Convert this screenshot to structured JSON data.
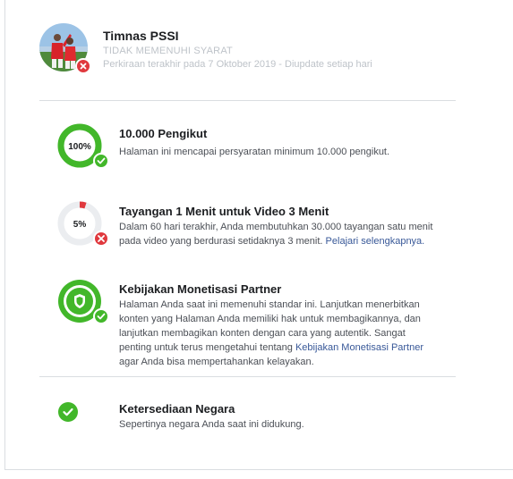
{
  "header": {
    "page_name": "Timnas PSSI",
    "status": "TIDAK MEMENUHI SYARAT",
    "estimate": "Perkiraan terakhir pada 7 Oktober 2019 - Diupdate setiap hari"
  },
  "items": [
    {
      "progress_label": "100%",
      "progress": 1.0,
      "status_icon": "check-icon",
      "title": "10.000 Pengikut",
      "desc": "Halaman ini mencapai persyaratan minimum 10.000 pengikut."
    },
    {
      "progress_label": "5%",
      "progress": 0.05,
      "status_icon": "x-icon",
      "title": "Tayangan 1 Menit untuk Video 3 Menit",
      "desc": "Dalam 60 hari terakhir, Anda membutuhkan 30.000 tayangan satu menit pada video yang berdurasi setidaknya 3 menit.",
      "link": "Pelajari selengkapnya."
    },
    {
      "status_icon": "check-icon",
      "center_icon": "shield-icon",
      "title": "Kebijakan Monetisasi Partner",
      "desc_before": "Halaman Anda saat ini memenuhi standar ini. Lanjutkan menerbitkan konten yang Halaman Anda memiliki hak untuk membagikannya, dan lanjutkan membagikan konten dengan cara yang autentik. Sangat penting untuk terus mengetahui tentang",
      "link": "Kebijakan Monetisasi Partner",
      "desc_after": "agar Anda bisa mempertahankan kelayakan."
    },
    {
      "status_icon": "check-icon",
      "title": "Ketersediaan Negara",
      "desc": "Sepertinya negara Anda saat ini didukung."
    }
  ],
  "colors": {
    "green": "#42b72a",
    "green_dark": "#36a420",
    "red": "#e0393e",
    "track": "#ebedf0",
    "link": "#385898"
  }
}
